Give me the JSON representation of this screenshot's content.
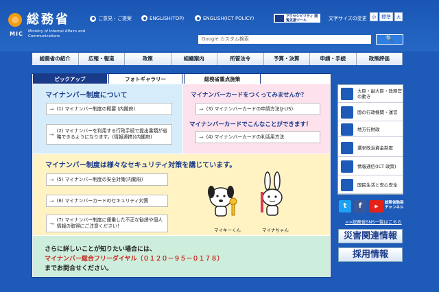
{
  "header": {
    "logo_name": "総務省",
    "logo_mic": "MIC",
    "logo_en": "Ministry of Internal Affairs and Communications",
    "links": [
      "ご意見・ご提案",
      "ENGLISH(TOP)",
      "ENGLISH(ICT POLICY)"
    ],
    "accessibility_label": "アクセシビリティ 閲覧支援ツール",
    "font_size_label": "文字サイズの変更",
    "font_sizes": [
      "小",
      "標準",
      "大"
    ],
    "search_placeholder": "Google カスタム検索",
    "search_button": "🔍"
  },
  "nav": [
    "総務省の紹介",
    "広報・報道",
    "政策",
    "組織案内",
    "所管法令",
    "予算・決算",
    "申請・手続",
    "政策評価"
  ],
  "tabs": [
    "ピックアップ",
    "フォトギャラリー",
    "総務省重点施策"
  ],
  "pickup": {
    "sec1_title": "マイナンバー制度について",
    "sec1_items": [
      "(1) マイナンバー制度の概要 (内閣府)",
      "(2) マイナンバーを利用する行政手続で提出書類が省略できるようになります。(情報連携)(内閣府)"
    ],
    "sec2_title": "マイナンバーカードをつくってみませんか？",
    "sec2_items": [
      "(3) マイナンバーカードの申請方法(J-LIS)"
    ],
    "sec2b_title": "マイナンバーカードでこんなことができます！",
    "sec2b_items": [
      "(4) マイナンバーカードの利活用方法"
    ],
    "sec3_title": "マイナンバー制度は様々なセキュリティ対策を講じています。",
    "sec3_items": [
      "(5) マイナンバー制度の安全対策(内閣府)",
      "(6) マイナンバーカードのセキュリティ対策",
      "(7) マイナンバー制度に便乗した不正な勧誘や個人情報の取得にご注意ください！"
    ],
    "mascot1": "マイキーくん",
    "mascot2": "マイナちゃん",
    "footer_line1": "さらに詳しいことが知りたい場合には、",
    "footer_line2": "マイナンバー総合フリーダイヤル（０１２０－９５－０１７８）",
    "footer_line3": "までお問合せください。"
  },
  "sidebar": {
    "items": [
      "大臣・副大臣・政務官の動き",
      "国の行政機関・運営",
      "地方行財政",
      "選挙政治資金制度",
      "情報通信(ICT 政策)",
      "国民生活と安心安全"
    ],
    "youtube_label": "総務省動画チャンネル",
    "sns_link": ">>総務省SNS一覧はこちら",
    "disaster_button": "災害関連情報",
    "recruit_button": "採用情報"
  },
  "colors": {
    "brand_blue": "#1e5bb8",
    "logo_orange": "#f39c12",
    "alert_red": "#c8251a"
  }
}
